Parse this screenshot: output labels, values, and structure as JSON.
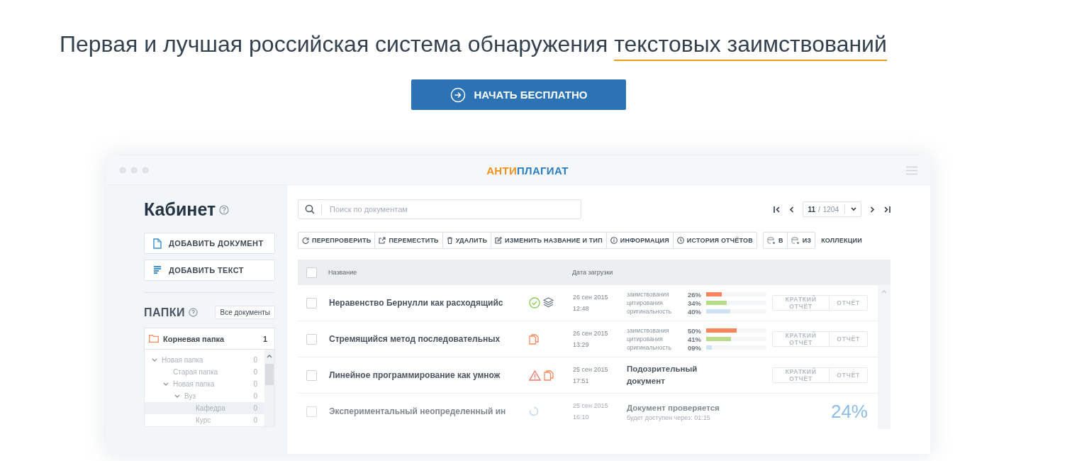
{
  "headline": {
    "text": "Первая и лучшая российская система обнаружения ",
    "underlined": "текстовых заимствований"
  },
  "cta_button": "НАЧАТЬ БЕСПЛАТНО",
  "app": {
    "logo": {
      "part_1": "АНТИ",
      "part_2": "ПЛАГИАТ"
    },
    "sidebar": {
      "title": "Кабинет",
      "buttons": [
        {
          "label": "ДОБАВИТЬ ДОКУМЕНТ",
          "kind": "document"
        },
        {
          "label": "ДОБАВИТЬ ТЕКСТ",
          "kind": "text"
        }
      ],
      "folders_title": "ПАПКИ",
      "all_documents": "Все документы",
      "root_folder": {
        "name": "Корневая папка",
        "count": "1"
      },
      "tree": [
        {
          "name": "Новая папка",
          "count": "0",
          "expanded": true,
          "selected": false,
          "children": [
            {
              "name": "Старая папка",
              "count": "0",
              "selected": false
            },
            {
              "name": "Новая папка",
              "count": "0",
              "expanded": true,
              "selected": false,
              "children": [
                {
                  "name": "Вуз",
                  "count": "0",
                  "expanded": true,
                  "selected": false,
                  "children": [
                    {
                      "name": "Кафедра",
                      "count": "0",
                      "selected": true
                    },
                    {
                      "name": "Курс",
                      "count": "0",
                      "selected": false
                    }
                  ]
                }
              ]
            }
          ]
        }
      ]
    },
    "search": {
      "placeholder": "Поиск по документам"
    },
    "pagination": {
      "current": "11",
      "separator": "/",
      "total": "1204"
    },
    "toolbar": [
      {
        "label": "ПЕРЕПРОВЕРИТЬ",
        "kind": "recheck"
      },
      {
        "label": "ПЕРЕМЕСТИТЬ",
        "kind": "move"
      },
      {
        "label": "УДАЛИТЬ",
        "kind": "delete"
      },
      {
        "label": "ИЗМЕНИТЬ НАЗВАНИЕ И ТИП",
        "kind": "rename"
      },
      {
        "label": "ИНФОРМАЦИЯ",
        "kind": "info"
      },
      {
        "label": "ИСТОРИЯ ОТЧЁТОВ",
        "kind": "history"
      }
    ],
    "collection": {
      "buttons": [
        "В",
        "ИЗ"
      ],
      "label": "КОЛЛЕКЦИИ"
    },
    "table": {
      "columns": [
        "Название",
        "Дата загрузки"
      ],
      "select_all_checked": false,
      "rows": [
        {
          "kind": "report",
          "checked": false,
          "title": "Неравенство Бернулли как расходящийс",
          "icons": [
            {
              "kind": "ok"
            },
            {
              "kind": "collection"
            }
          ],
          "date": "26 сен 2015",
          "time": "12:48",
          "metrics": [
            {
              "label": "заимствования",
              "value": "26%",
              "level": 0.26,
              "color": "#f5855a"
            },
            {
              "label": "цитирования",
              "value": "34%",
              "level": 0.34,
              "color": "#b9dc8a"
            },
            {
              "label": "оригинальность",
              "value": "40%",
              "level": 0.4,
              "color": "#cfe4f3"
            }
          ],
          "buttons": [
            "КРАТКИЙ ОТЧЁТ",
            "ОТЧЁТ"
          ]
        },
        {
          "kind": "report",
          "checked": false,
          "title": "Стремящийся метод последовательных",
          "icons": [
            {
              "kind": "copy"
            }
          ],
          "date": "26 сен 2015",
          "time": "13:29",
          "metrics": [
            {
              "label": "заимствования",
              "value": "50%",
              "level": 0.5,
              "color": "#f5855a"
            },
            {
              "label": "цитирования",
              "value": "41%",
              "level": 0.41,
              "color": "#b9dc8a"
            },
            {
              "label": "оригинальность",
              "value": "09%",
              "level": 0.09,
              "color": "#cfe4f3"
            }
          ],
          "buttons": [
            "КРАТКИЙ ОТЧЁТ",
            "ОТЧЁТ"
          ]
        },
        {
          "kind": "suspicious",
          "checked": false,
          "title": "Линейное программирование как умнож",
          "icons": [
            {
              "kind": "warning"
            },
            {
              "kind": "copy"
            }
          ],
          "date": "25 сен 2015",
          "time": "17:51",
          "status": "Подозрительный документ",
          "buttons": [
            "КРАТКИЙ ОТЧЁТ",
            "ОТЧЁТ"
          ]
        },
        {
          "kind": "processing",
          "checked": false,
          "title": "Экспериментальный неопределенный ин",
          "icons": [
            {
              "kind": "loading"
            }
          ],
          "date": "25 сен 2015",
          "time": "16:10",
          "status": "Документ проверяется",
          "note": "будет доступен через: 01:15",
          "progress": "24%"
        }
      ]
    }
  }
}
